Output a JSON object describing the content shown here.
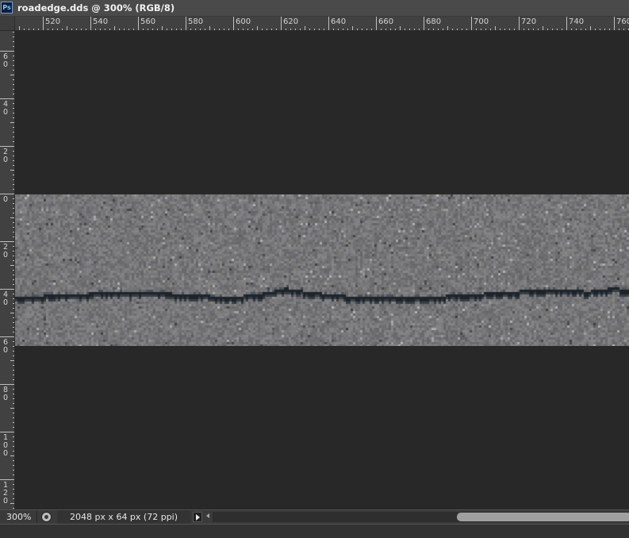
{
  "app": {
    "icon_label": "Ps",
    "document_title": "roadedge.dds @ 300% (RGB/8)"
  },
  "ruler_horizontal": {
    "labels": [
      "520",
      "540",
      "560",
      "580",
      "600",
      "620",
      "640",
      "660",
      "680",
      "700",
      "720",
      "740",
      "760"
    ]
  },
  "ruler_vertical": {
    "labels": [
      "60",
      "40",
      "20",
      "0",
      "20",
      "40",
      "60",
      "80",
      "100",
      "120"
    ]
  },
  "canvas": {
    "background_color": "#282828",
    "texture_color": "#7a7a7a",
    "crack_color": "#1f252b"
  },
  "status_bar": {
    "zoom": "300%",
    "document_info": "2048 px x 64 px (72 ppi)"
  }
}
